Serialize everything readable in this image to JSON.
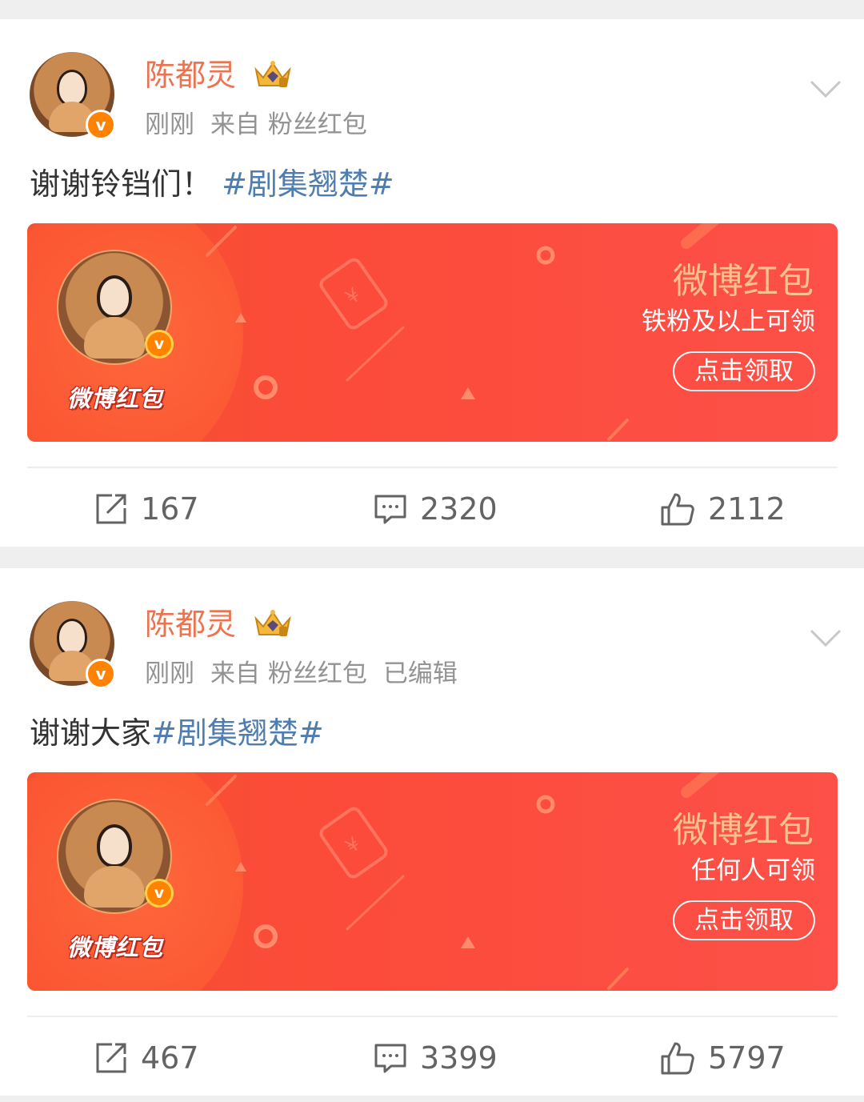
{
  "posts": [
    {
      "username": "陈都灵",
      "meta": [
        "刚刚",
        "来自 粉丝红包"
      ],
      "text_plain": "谢谢铃铛们！ ",
      "text_topic": "#剧集翘楚#",
      "hongbao": {
        "title": "微博红包",
        "subtitle": "铁粉及以上可领",
        "claim_label": "点击领取",
        "logo_text": "微博红包"
      },
      "actions": {
        "reposts": "167",
        "comments": "2320",
        "likes": "2112"
      }
    },
    {
      "username": "陈都灵",
      "meta": [
        "刚刚",
        "来自 粉丝红包",
        "已编辑"
      ],
      "text_plain": "谢谢大家",
      "text_topic": "#剧集翘楚#",
      "hongbao": {
        "title": "微博红包",
        "subtitle": "任何人可领",
        "claim_label": "点击领取",
        "logo_text": "微博红包"
      },
      "actions": {
        "reposts": "467",
        "comments": "3399",
        "likes": "5797"
      }
    }
  ],
  "icons": {
    "avatar_badge": "v",
    "crown": "crown-icon",
    "menu": "chevron-down-icon",
    "repost": "repost-icon",
    "comment": "comment-icon",
    "like": "like-icon"
  },
  "colors": {
    "username": "#eb7350",
    "topic": "#507daf",
    "hongbao_bg": "#fc4b3a",
    "hongbao_title": "#ffc08d",
    "meta": "#939393"
  }
}
